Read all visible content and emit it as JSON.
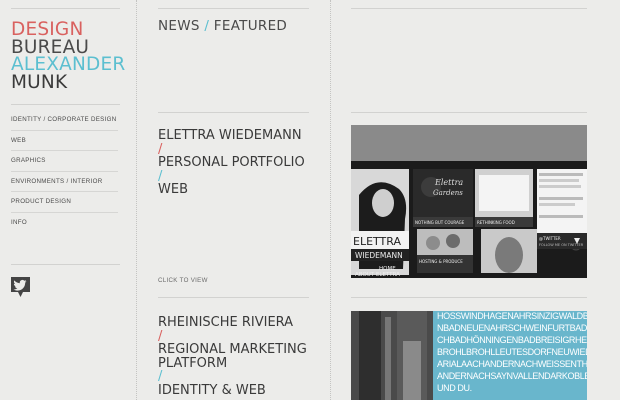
{
  "brand": {
    "lines": [
      "DESIGN",
      "BUREAU",
      "ALEXANDER",
      "MUNK"
    ],
    "colors": [
      "#d9615f",
      "#4a4a4a",
      "#5cbfd0",
      "#3a3a3a"
    ]
  },
  "nav": {
    "items": [
      {
        "label": "IDENTITY / CORPORATE DESIGN"
      },
      {
        "label": "WEB"
      },
      {
        "label": "GRAPHICS"
      },
      {
        "label": "ENVIRONMENTS / INTERIOR"
      },
      {
        "label": "PRODUCT DESIGN"
      },
      {
        "label": "INFO"
      }
    ]
  },
  "social": {
    "icon": "twitter-bird-icon"
  },
  "breadcrumb": {
    "news": "NEWS",
    "sep": "/",
    "featured": "FEATURED"
  },
  "projects": [
    {
      "title": "ELETTRA WIEDEMANN",
      "subtitle": "PERSONAL PORTFOLIO",
      "category": "WEB",
      "cta": "CLICK TO VIEW",
      "thumb": {
        "brand_line1": "ELETTRA",
        "brand_line2": "WIEDEMANN",
        "nav_a": "HOME",
        "nav_b": "ABOUT ELETTRA",
        "tile_caption_1": "NOTHING BUT COURAGE",
        "tile_caption_2": "RETHINKING FOOD",
        "tile_caption_3": "HOSTING & PRODUCE",
        "tile_caption_4": "FOLLOW ME ON TWITTER",
        "twitter_handle": "@TWITTER"
      }
    },
    {
      "title": "RHEINISCHE RIVIERA",
      "subtitle_line1": "REGIONAL MARKETING",
      "subtitle_line2": "PLATFORM",
      "category": "IDENTITY & WEB",
      "thumb_text": [
        "HOSSWINDHAGENAHRSINZIGWALDBREITB",
        "NBADNEUENAHRSCHWEINFURTBADBREISIGRHEIN",
        "CHBADHÖNNINGENBADBREISIGRHEIN",
        "BROHLBROHLLEUTESDORFNEUWIEDM",
        "ARIALAACHANDERNACHWEISSENTHUR",
        "ANDERNACHSAYNVALLENDARKOBLENZ",
        "UND DU."
      ]
    }
  ],
  "colors": {
    "accent_red": "#d9615f",
    "accent_cyan": "#5cbfd0",
    "background": "#ececea"
  }
}
